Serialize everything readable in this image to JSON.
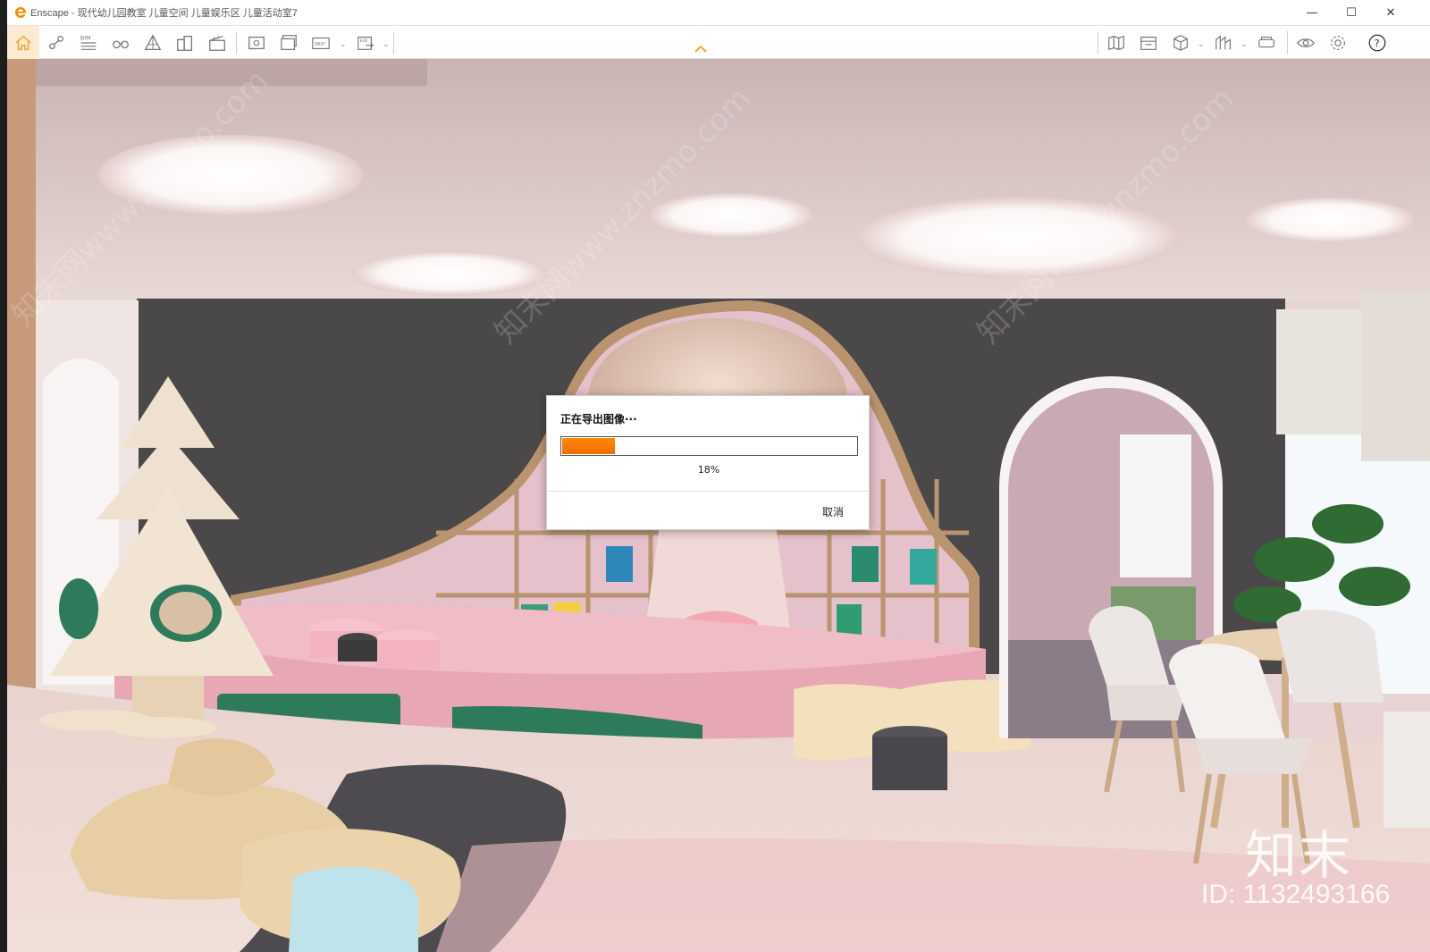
{
  "window": {
    "app_name": "Enscape",
    "title": "Enscape - 现代幼儿园教室 儿童空间 儿童娱乐区 儿童活动室7",
    "minimize_label": "—",
    "maximize_label": "☐",
    "close_label": "✕"
  },
  "toolbar": {
    "icons": [
      "home-icon",
      "navigate-icon",
      "bim-icon",
      "binoculars-icon",
      "perspective-icon",
      "buildings-icon",
      "clapper-icon",
      "screenshot-icon",
      "batch-render-icon",
      "panorama-icon",
      "export-exe-icon",
      "map-icon",
      "asset-library-icon",
      "cube-view-icon",
      "atlas-icon",
      "vr-headset-icon",
      "visibility-icon",
      "settings-icon",
      "help-icon"
    ],
    "bim_label": "BIM",
    "panorama_label": "360°",
    "exe_label": "EXE",
    "help_label": "?",
    "accent": "#f5a623"
  },
  "dialog": {
    "title": "正在导出图像···",
    "progress_percent": 18,
    "progress_text": "18%",
    "cancel_label": "取消",
    "progress_color": "#f27a00"
  },
  "watermark": {
    "logo": "知末",
    "id_text": "ID: 1132493166"
  }
}
